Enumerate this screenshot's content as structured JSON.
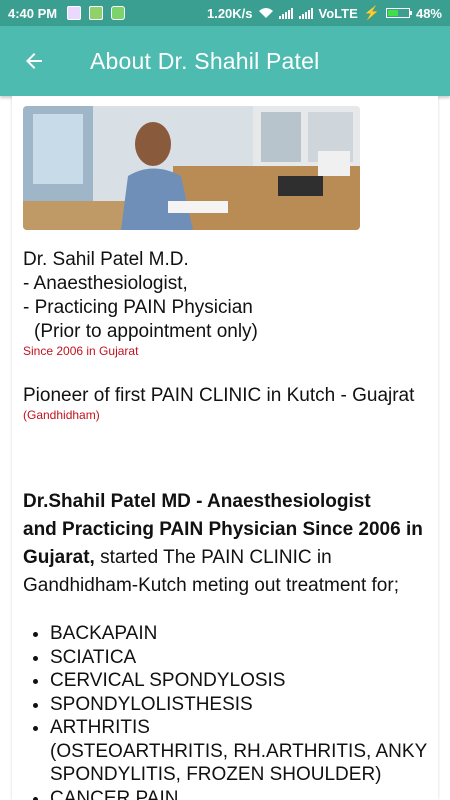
{
  "status_bar": {
    "time": "4:40 PM",
    "speed": "1.20K/s",
    "network": "VoLTE",
    "battery": "48%",
    "battery_level": 0.48
  },
  "app_bar": {
    "title": "About Dr. Shahil Patel",
    "back_icon": "arrow-left-icon"
  },
  "doctor": {
    "line1": "Dr. Sahil Patel M.D.",
    "line2": "- Anaesthesiologist,",
    "line3": "- Practicing PAIN Physician",
    "line4": "(Prior to appointment only)",
    "since": "Since 2006 in Gujarat"
  },
  "pioneer": {
    "text": "Pioneer of first PAIN CLINIC in Kutch - Guajrat",
    "place": "(Gandhidham)"
  },
  "intro": {
    "bold1": "Dr.Shahil Patel MD -  Anaesthesiologist",
    "bold2": "and Practicing PAIN Physician Since 2006 in",
    "bold3": "Gujarat,",
    "rest3": " started The PAIN CLINIC in",
    "line4": "Gandhidham-Kutch meting out treatment for;"
  },
  "treatments": [
    "BACKAPAIN",
    "SCIATICA",
    "CERVICAL SPONDYLOSIS",
    "SPONDYLOLISTHESIS",
    "ARTHRITIS",
    "CANCER PAIN"
  ],
  "arthritis_detail": {
    "line1": "(OSTEOARTHRITIS, RH.ARTHRITIS, ANKY",
    "line2": "SPONDYLITIS, FROZEN SHOULDER)"
  }
}
